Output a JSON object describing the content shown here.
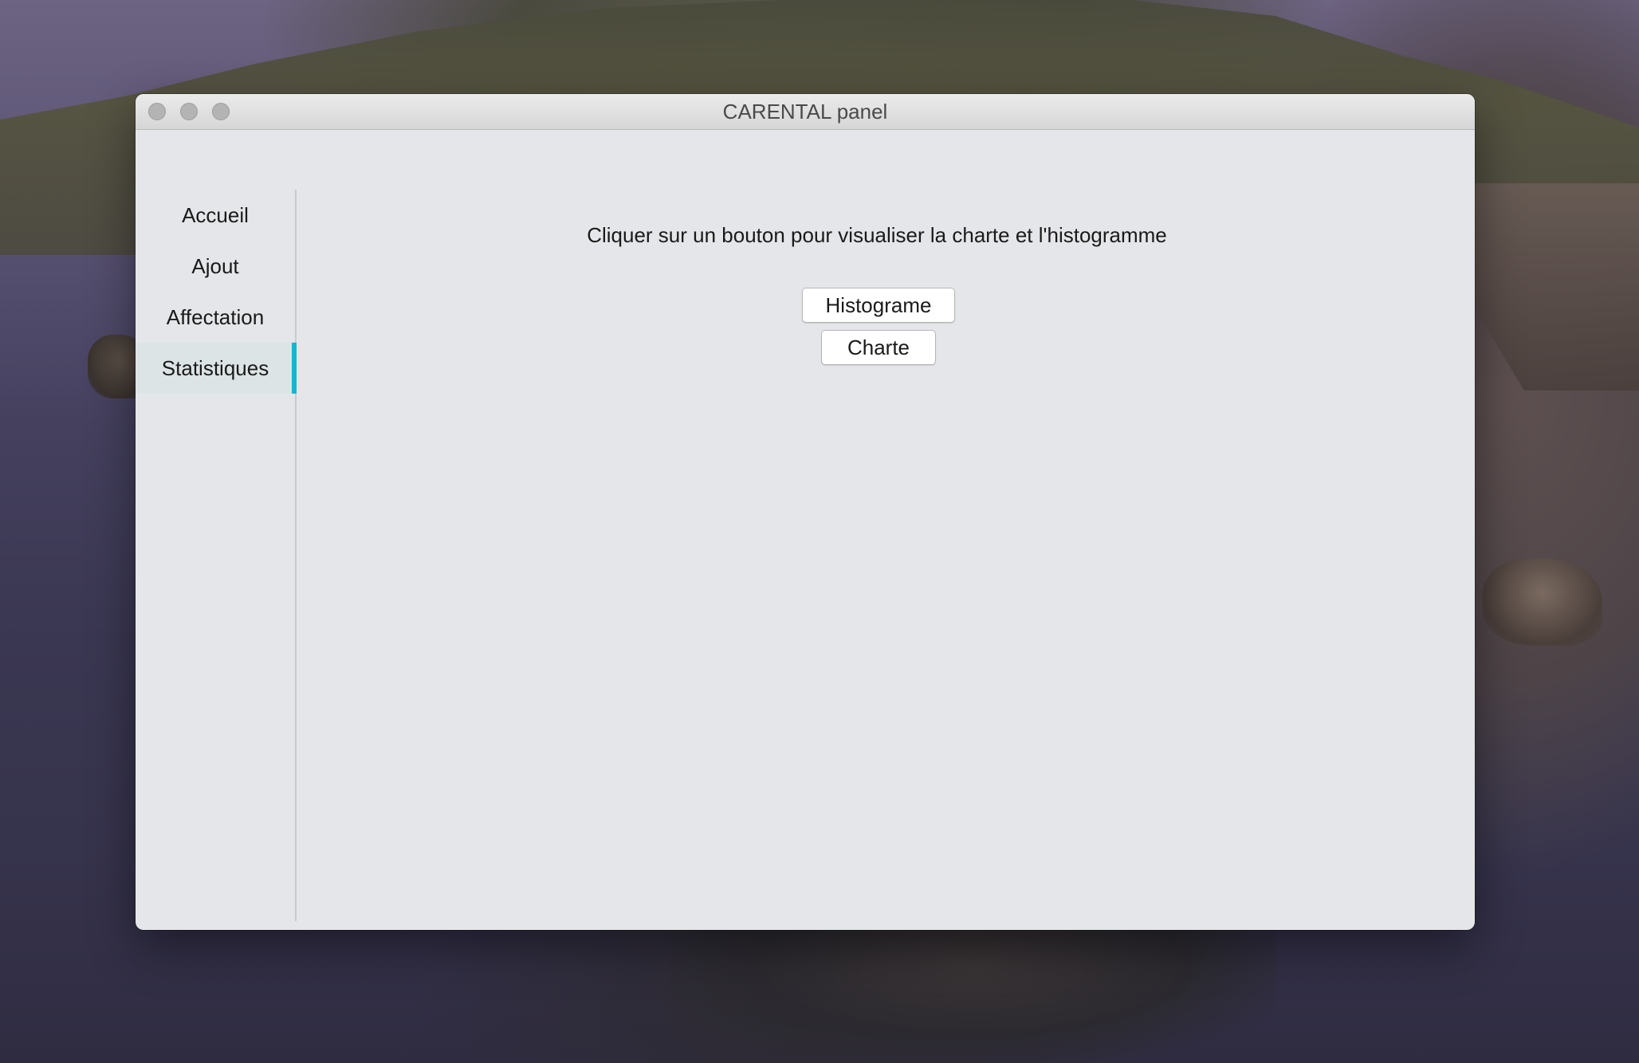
{
  "window": {
    "title": "CARENTAL panel"
  },
  "sidebar": {
    "items": [
      {
        "label": "Accueil",
        "active": false
      },
      {
        "label": "Ajout",
        "active": false
      },
      {
        "label": "Affectation",
        "active": false
      },
      {
        "label": "Statistiques",
        "active": true
      }
    ],
    "accent_color": "#17b3d3"
  },
  "main": {
    "instruction": "Cliquer sur un bouton pour visualiser la charte et l'histogramme",
    "buttons": {
      "histogram_label": "Histograme",
      "chart_label": "Charte"
    }
  }
}
